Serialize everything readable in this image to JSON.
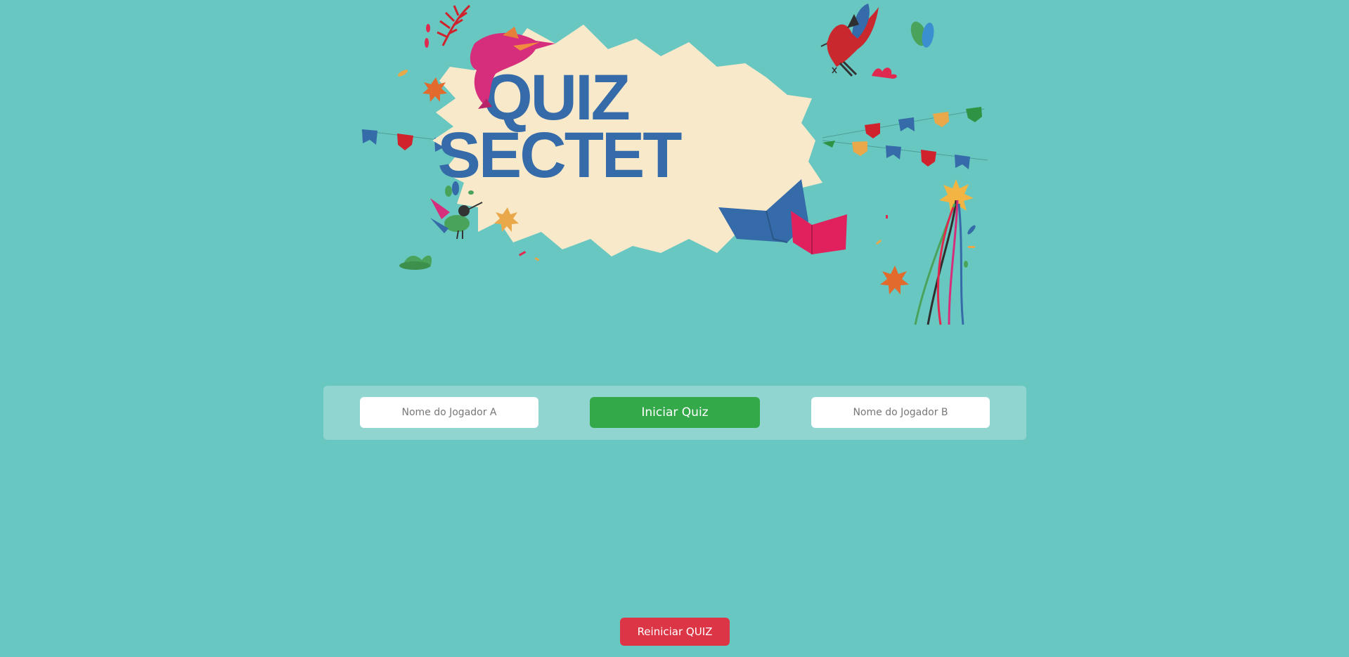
{
  "banner": {
    "title_line1": "QUIZ",
    "title_line2": "SECTET"
  },
  "player_a": {
    "placeholder": "Nome do Jogador A",
    "value": ""
  },
  "start_button": {
    "label": "Iniciar Quiz"
  },
  "player_b": {
    "placeholder": "Nome do Jogador B",
    "value": ""
  },
  "restart_button": {
    "label": "Reiniciar QUIZ"
  },
  "colors": {
    "background": "#68c7c0",
    "panel": "#91d5d1",
    "title": "#356ba8",
    "burst": "#f8e9cb",
    "start_button": "#34a94a",
    "restart_button": "#dc3545"
  },
  "icons": [
    "dolphin-icon",
    "bird-icon",
    "hummingbird-icon",
    "book-icon",
    "bunting-flags",
    "festival-pole-icon",
    "star-icon",
    "leaf-icon"
  ]
}
